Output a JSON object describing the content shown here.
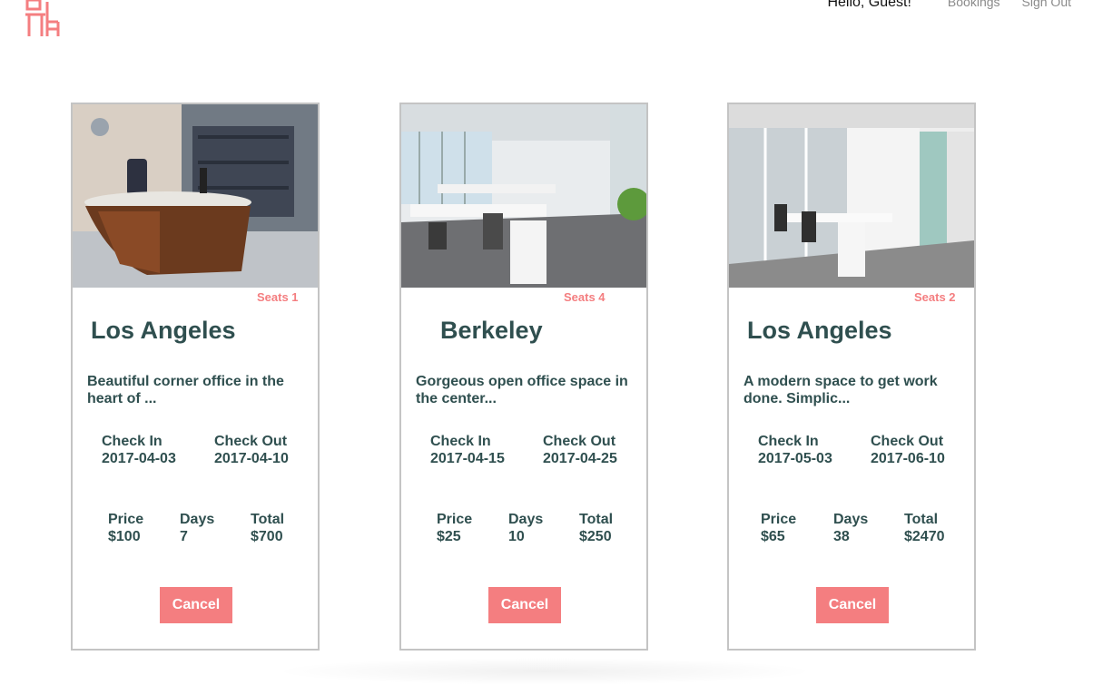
{
  "header": {
    "greeting": "Hello, Guest!",
    "nav_links": [
      "Bookings",
      "Sign Out"
    ],
    "brand_color": "#f47e80"
  },
  "bookings": [
    {
      "seats": "Seats 1",
      "city": "Los Angeles",
      "description": "Beautiful corner office in the heart of ...",
      "check_in_label": "Check In",
      "check_in": "2017-04-03",
      "check_out_label": "Check Out",
      "check_out": "2017-04-10",
      "price_label": "Price",
      "price": "$100",
      "days_label": "Days",
      "days": "7",
      "total_label": "Total",
      "total": "$700",
      "cancel_label": "Cancel"
    },
    {
      "seats": "Seats 4",
      "city": "Berkeley",
      "description": "Gorgeous open office space in the center...",
      "check_in_label": "Check In",
      "check_in": "2017-04-15",
      "check_out_label": "Check Out",
      "check_out": "2017-04-25",
      "price_label": "Price",
      "price": "$25",
      "days_label": "Days",
      "days": "10",
      "total_label": "Total",
      "total": "$250",
      "cancel_label": "Cancel"
    },
    {
      "seats": "Seats 2",
      "city": "Los Angeles",
      "description": "A modern space to get work done. Simplic...",
      "check_in_label": "Check In",
      "check_in": "2017-05-03",
      "check_out_label": "Check Out",
      "check_out": "2017-06-10",
      "price_label": "Price",
      "price": "$65",
      "days_label": "Days",
      "days": "38",
      "total_label": "Total",
      "total": "$2470",
      "cancel_label": "Cancel"
    }
  ]
}
